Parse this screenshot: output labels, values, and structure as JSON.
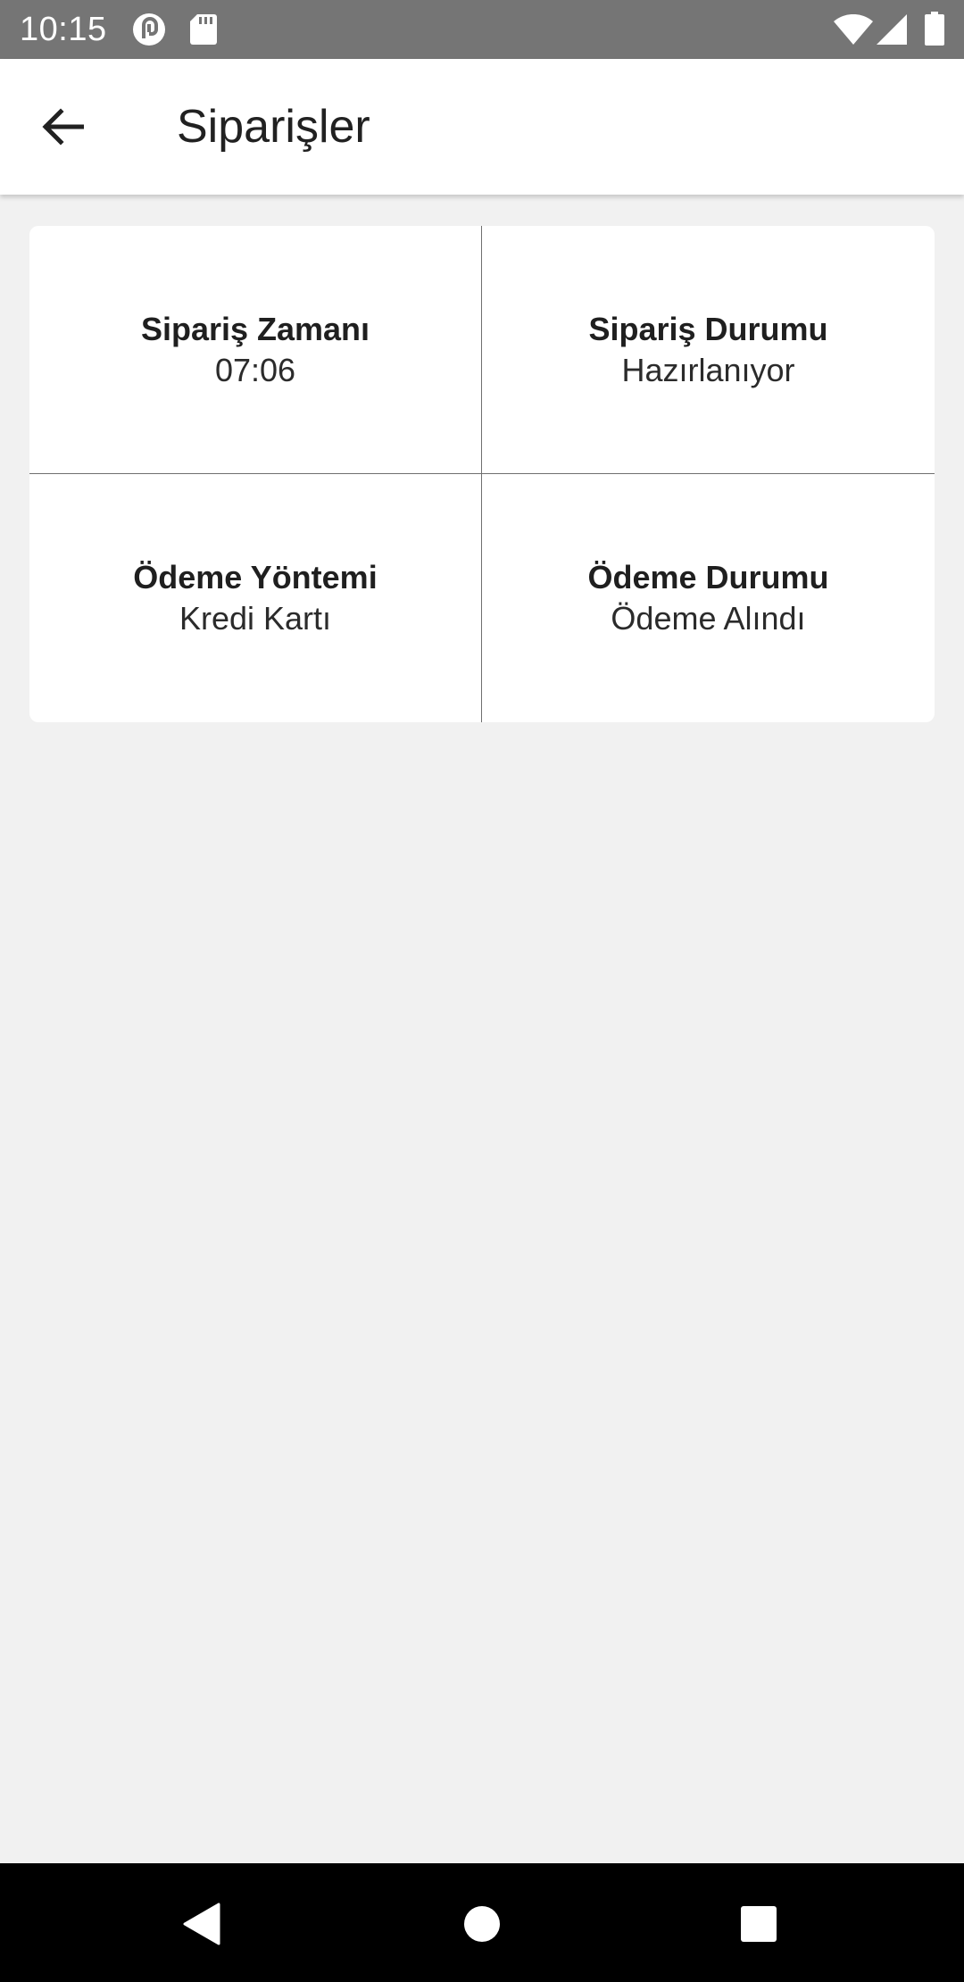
{
  "status_bar": {
    "time": "10:15",
    "icons": [
      "pocket-casts-icon",
      "sd-card-icon",
      "wifi-icon",
      "signal-icon",
      "battery-icon"
    ],
    "background": "#757575"
  },
  "app_bar": {
    "title": "Siparişler",
    "back_icon": "arrow-back-icon"
  },
  "order_info": {
    "order_time": {
      "label": "Sipariş Zamanı",
      "value": "07:06"
    },
    "order_status": {
      "label": "Sipariş Durumu",
      "value": "Hazırlanıyor"
    },
    "payment_method": {
      "label": "Ödeme Yöntemi",
      "value": "Kredi Kartı"
    },
    "payment_status": {
      "label": "Ödeme Durumu",
      "value": "Ödeme Alındı"
    }
  },
  "nav_bar": {
    "buttons": [
      "back-triangle-icon",
      "home-circle-icon",
      "recents-square-icon"
    ]
  },
  "colors": {
    "page_background": "#f1f1f1",
    "card_background": "#ffffff",
    "divider": "#6f6f6f"
  }
}
